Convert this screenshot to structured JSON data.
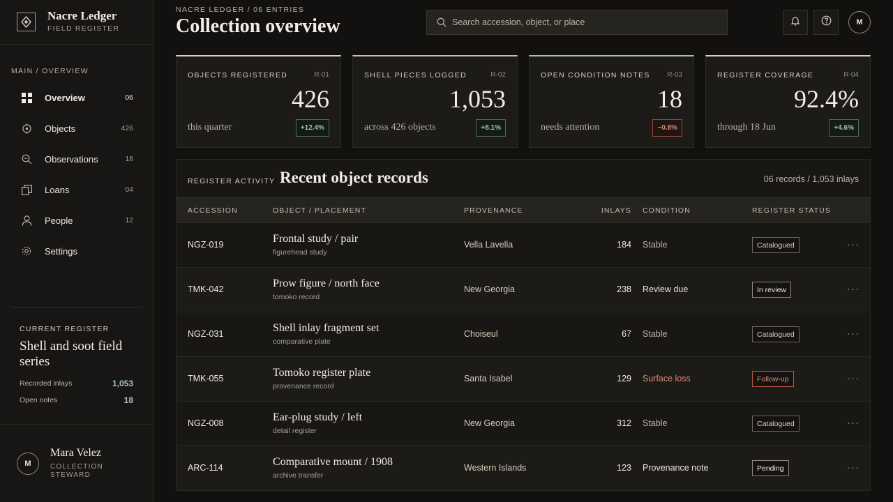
{
  "brand": {
    "name": "Nacre Ledger",
    "subtitle": "FIELD REGISTER"
  },
  "nav": {
    "section_label": "MAIN / OVERVIEW",
    "items": [
      {
        "label": "Overview",
        "count": "06",
        "icon": "grid-icon",
        "active": true
      },
      {
        "label": "Objects",
        "count": "426",
        "icon": "target-icon"
      },
      {
        "label": "Observations",
        "count": "18",
        "icon": "magnifier-minus-icon"
      },
      {
        "label": "Loans",
        "count": "04",
        "icon": "copy-icon"
      },
      {
        "label": "People",
        "count": "12",
        "icon": "person-icon"
      },
      {
        "label": "Settings",
        "count": "",
        "icon": "gear-icon"
      }
    ]
  },
  "register": {
    "label": "CURRENT REGISTER",
    "title": "Shell and soot field series",
    "stats": [
      {
        "label": "Recorded inlays",
        "value": "1,053"
      },
      {
        "label": "Open notes",
        "value": "18"
      }
    ]
  },
  "user": {
    "initial": "M",
    "name": "Mara Velez",
    "role": "COLLECTION STEWARD"
  },
  "header": {
    "breadcrumb": "NACRE LEDGER / 06 ENTRIES",
    "title": "Collection overview",
    "search_placeholder": "Search accession, object, or place",
    "avatar_initial": "M"
  },
  "cards": [
    {
      "label": "OBJECTS REGISTERED",
      "code": "R-01",
      "value": "426",
      "note": "this quarter",
      "delta": "+12.4%",
      "trend": "up",
      "accent": "#d8d2c6"
    },
    {
      "label": "SHELL PIECES LOGGED",
      "code": "R-02",
      "value": "1,053",
      "note": "across 426 objects",
      "delta": "+8.1%",
      "trend": "up",
      "accent": "#d9b9ad"
    },
    {
      "label": "OPEN CONDITION NOTES",
      "code": "R-03",
      "value": "18",
      "note": "needs attention",
      "delta": "−0.8%",
      "trend": "down",
      "accent": "#a9c0b6"
    },
    {
      "label": "REGISTER COVERAGE",
      "code": "R-04",
      "value": "92.4%",
      "note": "through 18 Jun",
      "delta": "+4.6%",
      "trend": "up",
      "accent": "#d8d2c6"
    }
  ],
  "table": {
    "eyebrow": "REGISTER ACTIVITY",
    "title": "Recent object records",
    "meta": "06 records / 1,053 inlays",
    "columns": [
      "ACCESSION",
      "OBJECT / PLACEMENT",
      "PROVENANCE",
      "INLAYS",
      "CONDITION",
      "REGISTER STATUS"
    ],
    "rows": [
      {
        "accession": "NGZ-019",
        "object": "Frontal study / pair",
        "placement": "figurehead study",
        "provenance": "Vella Lavella",
        "inlays": "184",
        "condition": "Stable",
        "status": "Catalogued"
      },
      {
        "accession": "TMK-042",
        "object": "Prow figure / north face",
        "placement": "tomoko record",
        "provenance": "New Georgia",
        "inlays": "238",
        "condition": "Review due",
        "status": "In review"
      },
      {
        "accession": "NGZ-031",
        "object": "Shell inlay fragment set",
        "placement": "comparative plate",
        "provenance": "Choiseul",
        "inlays": "67",
        "condition": "Stable",
        "status": "Catalogued"
      },
      {
        "accession": "TMK-055",
        "object": "Tomoko register plate",
        "placement": "provenance record",
        "provenance": "Santa Isabel",
        "inlays": "129",
        "condition": "Surface loss",
        "status": "Follow-up"
      },
      {
        "accession": "NGZ-008",
        "object": "Ear-plug study / left",
        "placement": "detail register",
        "provenance": "New Georgia",
        "inlays": "312",
        "condition": "Stable",
        "status": "Catalogued"
      },
      {
        "accession": "ARC-114",
        "object": "Comparative mount / 1908",
        "placement": "archive transfer",
        "provenance": "Western Islands",
        "inlays": "123",
        "condition": "Provenance note",
        "status": "Pending"
      }
    ]
  },
  "colors": {
    "up": "#9fc3b0",
    "down": "#e0886f",
    "accent_muted": "#a9c0b6"
  }
}
